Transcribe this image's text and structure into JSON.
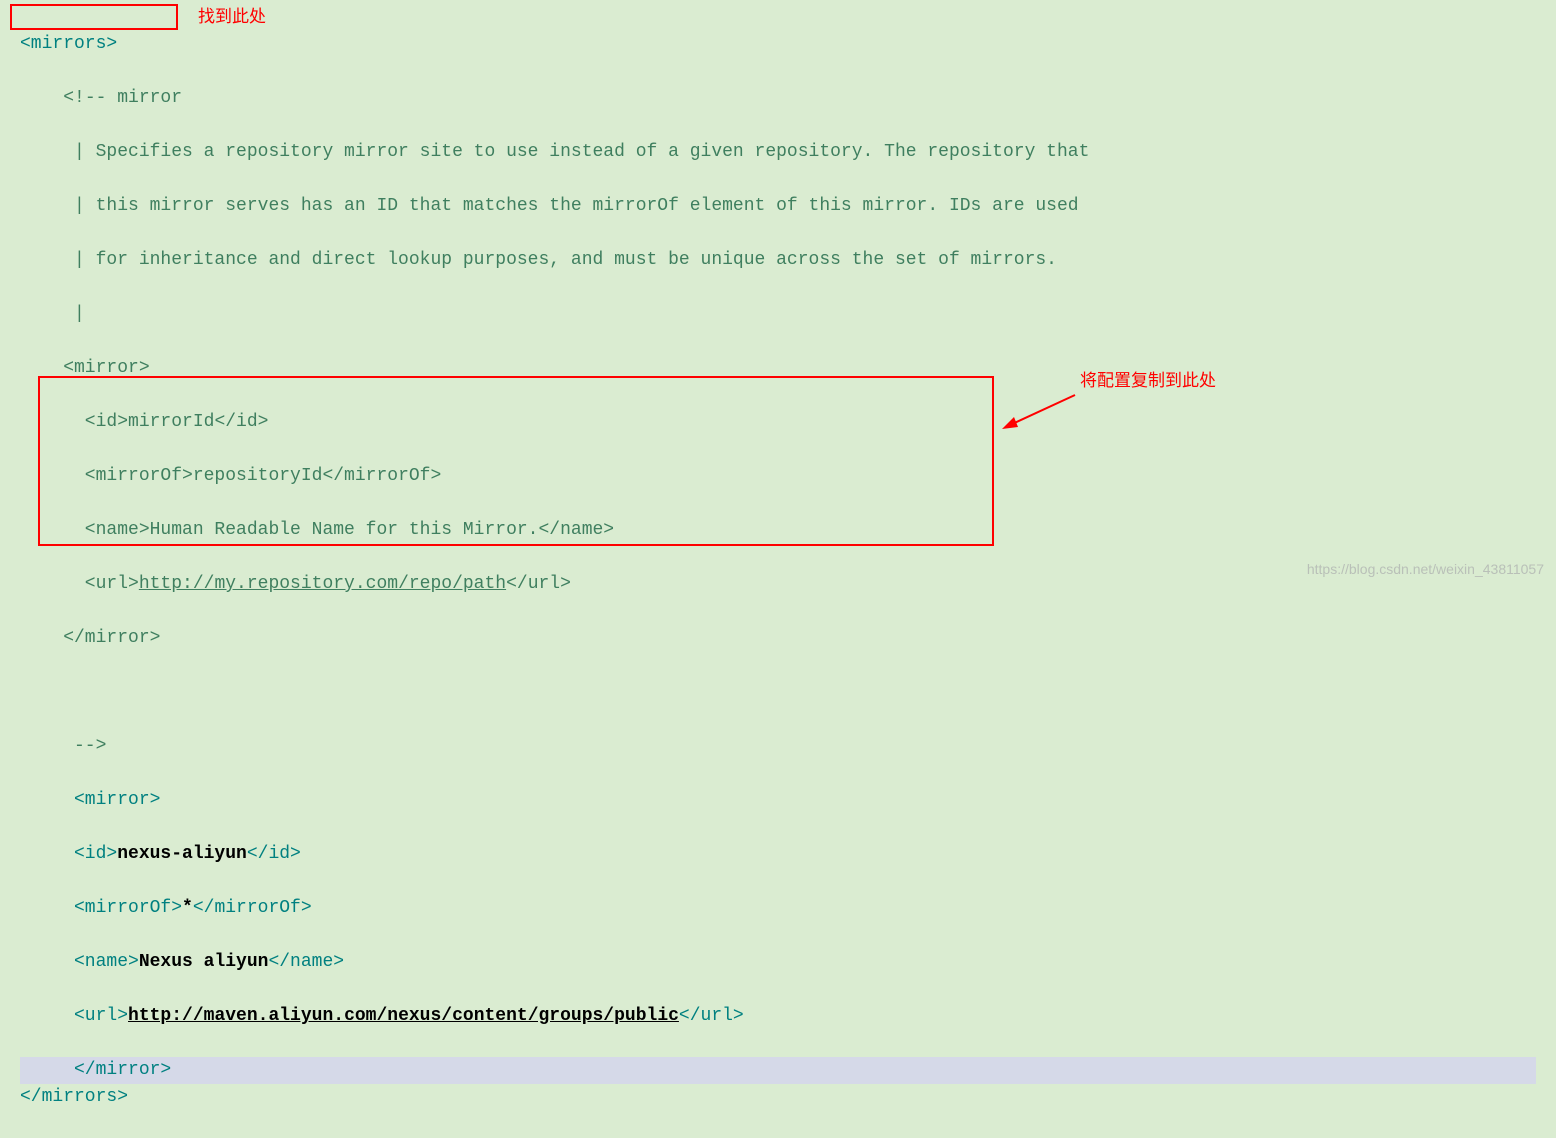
{
  "annotations": {
    "label1": "找到此处",
    "label2": "将配置复制到此处"
  },
  "code": {
    "l1": "<mirrors>",
    "l2a": "<!-- mirror",
    "l3": "     | Specifies a repository mirror site to use instead of a given repository. The repository that",
    "l4": "     | this mirror serves has an ID that matches the mirrorOf element of this mirror. IDs are used",
    "l5": "     | for inheritance and direct lookup purposes, and must be unique across the set of mirrors.",
    "l6": "     |",
    "l7": "    <mirror>",
    "l8a": "      <id>",
    "l8b": "mirrorId",
    "l8c": "</id>",
    "l9a": "      <mirrorOf>",
    "l9b": "repositoryId",
    "l9c": "</mirrorOf>",
    "l10a": "      <name>",
    "l10b": "Human Readable Name for this Mirror.",
    "l10c": "</name>",
    "l11a": "      <url>",
    "l11b": "http://my.repository.com/repo/path",
    "l11c": "</url>",
    "l12": "    </mirror>",
    "l13": "     ",
    "l14": "     -->",
    "m1": "     <mirror>",
    "m2a": "     <id>",
    "m2b": "nexus-aliyun",
    "m2c": "</id>",
    "m3a": "     <mirrorOf>",
    "m3b": "*",
    "m3c": "</mirrorOf>",
    "m4a": "     <name>",
    "m4b": "Nexus aliyun",
    "m4c": "</name>",
    "m5a": "     <url>",
    "m5b": "http://maven.aliyun.com/nexus/content/groups/public",
    "m5c": "</url>",
    "m6": "     </mirror>",
    "end": "</mirrors>"
  },
  "watermark": "https://blog.csdn.net/weixin_43811057"
}
